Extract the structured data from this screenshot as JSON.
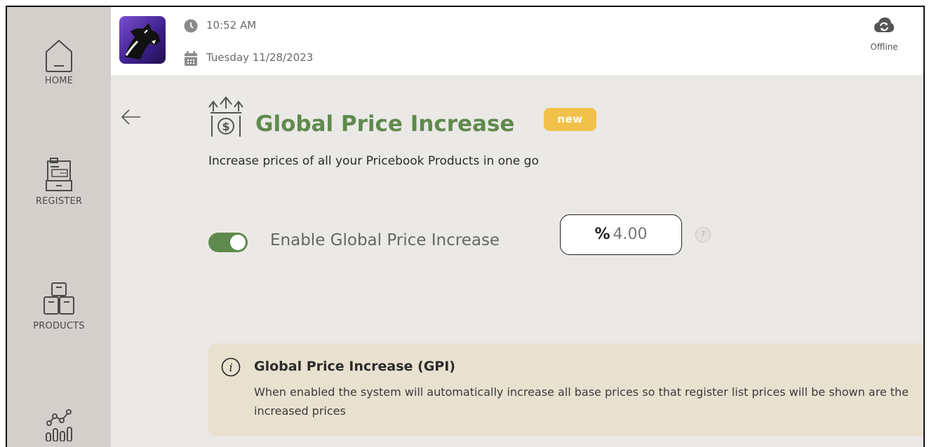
{
  "sidebar": {
    "items": [
      {
        "label": "HOME",
        "icon": "home-icon"
      },
      {
        "label": "REGISTER",
        "icon": "register-icon"
      },
      {
        "label": "PRODUCTS",
        "icon": "products-icon"
      },
      {
        "label": "",
        "icon": "reports-icon"
      }
    ]
  },
  "header": {
    "time": "10:52 AM",
    "date": "Tuesday 11/28/2023",
    "sync_status": "Offline"
  },
  "page": {
    "title": "Global Price Increase",
    "badge": "new",
    "subtitle": "Increase prices of all your Pricebook Products in one go",
    "toggle_label": "Enable Global Price Increase",
    "toggle_on": true,
    "percent_symbol": "%",
    "percent_value": "4.00",
    "help_glyph": "?"
  },
  "info": {
    "title": "Global Price Increase (GPI)",
    "text": "When enabled the system will automatically increase all base prices so that register list prices will be shown are the increased prices"
  },
  "colors": {
    "accent_green": "#5f8a4d",
    "badge_yellow": "#f1c14b",
    "sidebar_bg": "#d3d0cb",
    "main_bg": "#ebe9e6",
    "info_bg": "#e9e1cf"
  }
}
